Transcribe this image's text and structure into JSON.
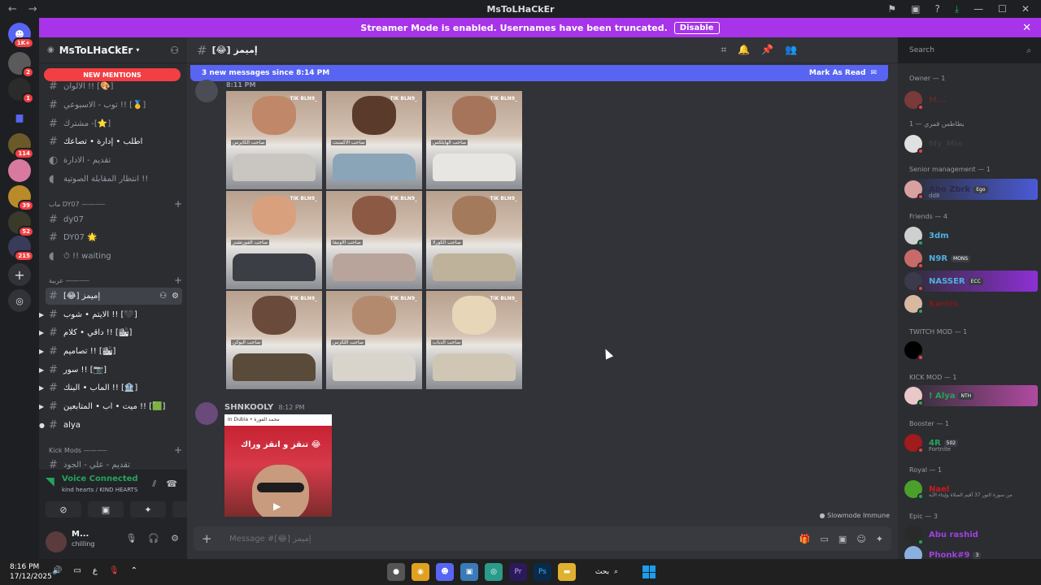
{
  "window": {
    "title": "MsToLHaCkEr",
    "back_icon": "←",
    "forward_icon": "→"
  },
  "streamer_banner": {
    "text": "Streamer Mode is enabled. Usernames have been truncated.",
    "disable_label": "Disable"
  },
  "rail": {
    "dm_badge": "1K+",
    "server_badges": [
      "2",
      "1",
      "114",
      "39",
      "52",
      "215"
    ]
  },
  "guild": {
    "name": "MsToLHaCkEr",
    "mentions_label": "NEW MENTIONS"
  },
  "channels": [
    {
      "name": "الالوان !! [🎨]"
    },
    {
      "name": "توب - الاسبوعي !! [🥇]"
    },
    {
      "name": "مشترك -[⭐]"
    },
    {
      "name": "اطلب • إدارة • تصاعك"
    },
    {
      "name": "تقديم - الادارة"
    },
    {
      "name": "انتظار المقابلة الصوتية !!"
    }
  ],
  "category_dy07": "ماب DY07 ——⸺",
  "channels2": [
    {
      "name": "dy07"
    },
    {
      "name": "DY07 🌟"
    },
    {
      "name": "⏱ !! waiting"
    }
  ],
  "category_chat": "عربية ——⸺",
  "channels3": [
    {
      "name": "[😂] إميمز"
    },
    {
      "name": "الايتم • شوب !! [🖤]"
    },
    {
      "name": "داقي • كلام !! [🏙]"
    },
    {
      "name": "تصاميم !! [🏙]"
    },
    {
      "name": "سور !! [📷]"
    },
    {
      "name": "الماب • البنك !! [🏦]"
    },
    {
      "name": "ميت • اب • المتابعين !! [🟩]"
    },
    {
      "name": "alya"
    }
  ],
  "category_kick": "Kick Mods ——⸺",
  "channels4": [
    {
      "name": "تقديم - علي - الجود"
    }
  ],
  "voice": {
    "title": "Voice Connected",
    "subtitle": "kind hearts / KIND HEARTS"
  },
  "user": {
    "name": "M...",
    "status": "chilling"
  },
  "chat": {
    "channel_name": "[😂] إميمز",
    "new_messages": "3 new messages since 8:14 PM",
    "mark_read": "Mark As Read",
    "first_time": "8:11 PM",
    "tiles": [
      {
        "cap": "صاحب الكابرس",
        "tt": "TiK BLN9_"
      },
      {
        "cap": "صاحب الاكسنت",
        "tt": "TiK BLN9_"
      },
      {
        "cap": "صاحب الهايلكس",
        "tt": "TiK BLN9_"
      },
      {
        "cap": "صاحب الفورتشنر",
        "tt": "TiK BLN9_"
      },
      {
        "cap": "صاحب الاونيفا",
        "tt": "TiK BLN9_"
      },
      {
        "cap": "صاحب الكورلا",
        "tt": "TiK BLN9_"
      },
      {
        "cap": "صاحب اليوكن",
        "tt": "TiK BLN9_"
      },
      {
        "cap": "صاحب اللكزس",
        "tt": "TiK BLN9_"
      },
      {
        "cap": "صاحب الدباب",
        "tt": "TiK BLN9_"
      }
    ],
    "second_author": "SHNKOOLY",
    "second_time": "8:12 PM",
    "embed_top": "In Dubia • محمد الفورة",
    "embed_text": "تنقز و انقز وراك 😂",
    "slowmode": "Slowmode Immune",
    "composer_placeholder": "Message #[😂] إميمز",
    "search_placeholder": "Search"
  },
  "members": {
    "groups": [
      {
        "label": "Owner — 1"
      },
      {
        "label": "بطاطس قمري — 1"
      },
      {
        "label": "Senior management — 1"
      },
      {
        "label": "Friends — 4"
      },
      {
        "label": "TWITCH MOD — 1"
      },
      {
        "label": "KICK MOD — 1"
      },
      {
        "label": "Booster — 1"
      },
      {
        "label": "Royal — 1"
      },
      {
        "label": "Epic — 3"
      }
    ],
    "list": [
      {
        "name": "M...",
        "color": "#5a2b2b",
        "tag": "",
        "sub": ""
      },
      {
        "name": "My_Min",
        "color": "#3b3b3b",
        "tag": "",
        "sub": ""
      },
      {
        "name": "Abo Zbrk",
        "color": "#2a2a4a",
        "tag": "Ego",
        "sub": "dd8"
      },
      {
        "name": "3dm",
        "color": "#4fb0e0",
        "tag": "",
        "sub": ""
      },
      {
        "name": "N9R",
        "color": "#4fb0e0",
        "tag": "MONS",
        "sub": ""
      },
      {
        "name": "NASSER",
        "color": "#4fb0e0",
        "tag": "ECC",
        "sub": ""
      },
      {
        "name": "Karnis",
        "color": "#7a1b1b",
        "tag": "",
        "sub": ""
      },
      {
        "name": "",
        "color": "#1e1e1e",
        "tag": "",
        "sub": ""
      },
      {
        "name": "! Alya",
        "color": "#23a55a",
        "tag": "NTH",
        "sub": ""
      },
      {
        "name": "4R",
        "color": "#23a55a",
        "tag": "502",
        "sub": "Fortnite"
      },
      {
        "name": "Nael",
        "color": "#c81b1b",
        "tag": "",
        "sub": "من سورة النور 37 أقيم الصلاة وإيتاء الآية"
      },
      {
        "name": "Abu rashid",
        "color": "#a33fe0",
        "tag": "",
        "sub": ""
      },
      {
        "name": "Phonk#9",
        "color": "#a33fe0",
        "tag": "3",
        "sub": ""
      }
    ]
  },
  "taskbar": {
    "time": "8:16 PM",
    "date": "17/12/2025",
    "search_label": "بحث",
    "lang": "ع"
  }
}
